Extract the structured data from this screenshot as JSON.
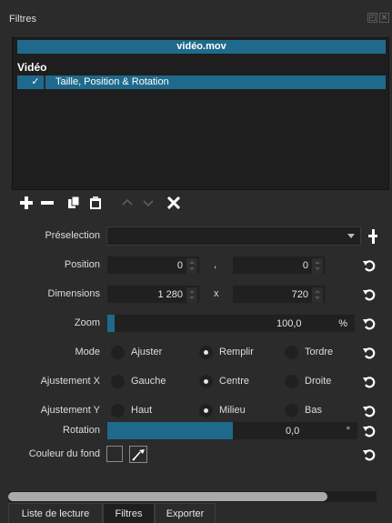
{
  "panel": {
    "title": "Filtres"
  },
  "filters": {
    "file_name": "vidéo.mov",
    "section_label": "Vidéo",
    "items": [
      {
        "checked": "✓",
        "label": "Taille, Position & Rotation"
      }
    ]
  },
  "toolbar": {
    "add_icon": "plus-icon",
    "remove_icon": "minus-icon",
    "copy_icon": "copy-icon",
    "paste_icon": "paste-icon",
    "up_icon": "chevron-up-icon",
    "down_icon": "chevron-down-icon",
    "close_icon": "close-icon"
  },
  "form": {
    "preset": {
      "label": "Préselection",
      "value": ""
    },
    "position": {
      "label": "Position",
      "x": "0",
      "sep": ",",
      "y": "0"
    },
    "dimensions": {
      "label": "Dimensions",
      "w": "1 280",
      "sep": "x",
      "h": "720"
    },
    "zoom": {
      "label": "Zoom",
      "value": "100,0",
      "unit": "%",
      "level": 0.03
    },
    "mode": {
      "label": "Mode",
      "options": [
        "Ajuster",
        "Remplir",
        "Tordre"
      ],
      "selected": "Remplir"
    },
    "halign": {
      "label": "Ajustement X",
      "options": [
        "Gauche",
        "Centre",
        "Droite"
      ],
      "selected": "Centre"
    },
    "valign": {
      "label": "Ajustement Y",
      "options": [
        "Haut",
        "Milieu",
        "Bas"
      ],
      "selected": "Milieu"
    },
    "rotation": {
      "label": "Rotation",
      "value": "0,0",
      "unit": "°",
      "level": 0.5
    },
    "background": {
      "label": "Couleur du fond",
      "color": "#2a2a2a"
    }
  },
  "tabs": [
    {
      "label": "Liste de lecture",
      "active": false
    },
    {
      "label": "Filtres",
      "active": true
    },
    {
      "label": "Exporter",
      "active": false
    }
  ],
  "colors": {
    "accent": "#1f6a8c",
    "background": "#2b2b2b",
    "field": "#202020"
  }
}
